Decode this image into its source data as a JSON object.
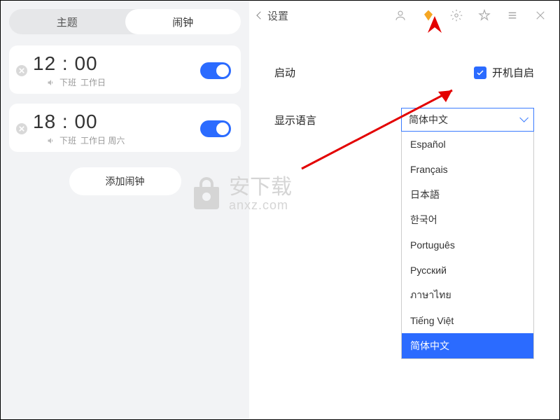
{
  "tabs": {
    "theme": "主题",
    "alarm": "闹钟"
  },
  "alarms": [
    {
      "time": "12 : 00",
      "label": "下班",
      "days": "工作日"
    },
    {
      "time": "18 : 00",
      "label": "下班",
      "days": "工作日 周六"
    }
  ],
  "add_alarm": "添加闹钟",
  "settings_title": "设置",
  "rows": {
    "startup": {
      "label": "启动",
      "checkbox_label": "开机自启"
    },
    "language": {
      "label": "显示语言",
      "selected": "简体中文"
    }
  },
  "language_options": [
    "Español",
    "Français",
    "日本語",
    "한국어",
    "Português",
    "Русский",
    "ภาษาไทย",
    "Tiếng Việt",
    "简体中文"
  ],
  "watermark": {
    "cn": "安下载",
    "en": "anxz.com"
  }
}
